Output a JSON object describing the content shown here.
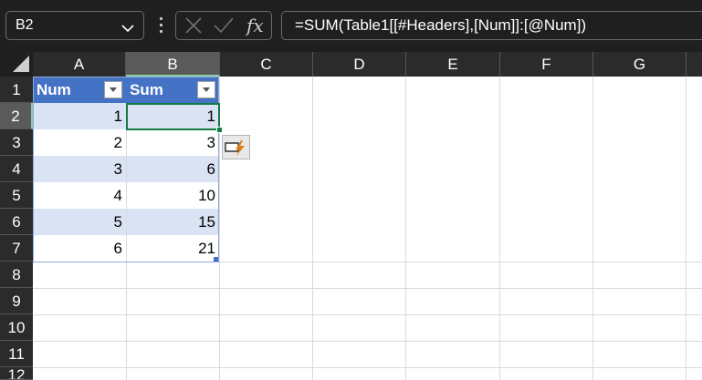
{
  "formula_bar": {
    "name_box": "B2",
    "formula": "=SUM(Table1[[#Headers],[Num]]:[@Num])"
  },
  "columns": [
    "A",
    "B",
    "C",
    "D",
    "E",
    "F",
    "G"
  ],
  "rows": [
    "1",
    "2",
    "3",
    "4",
    "5",
    "6",
    "7",
    "8",
    "9",
    "10",
    "11",
    "12"
  ],
  "table": {
    "headers": [
      "Num",
      "Sum"
    ],
    "rows": [
      [
        "1",
        "1"
      ],
      [
        "2",
        "3"
      ],
      [
        "3",
        "6"
      ],
      [
        "4",
        "10"
      ],
      [
        "5",
        "15"
      ],
      [
        "6",
        "21"
      ]
    ]
  },
  "colors": {
    "header_fill": "#4472c4",
    "band_fill": "#dae3f3",
    "selection": "#107c41"
  }
}
